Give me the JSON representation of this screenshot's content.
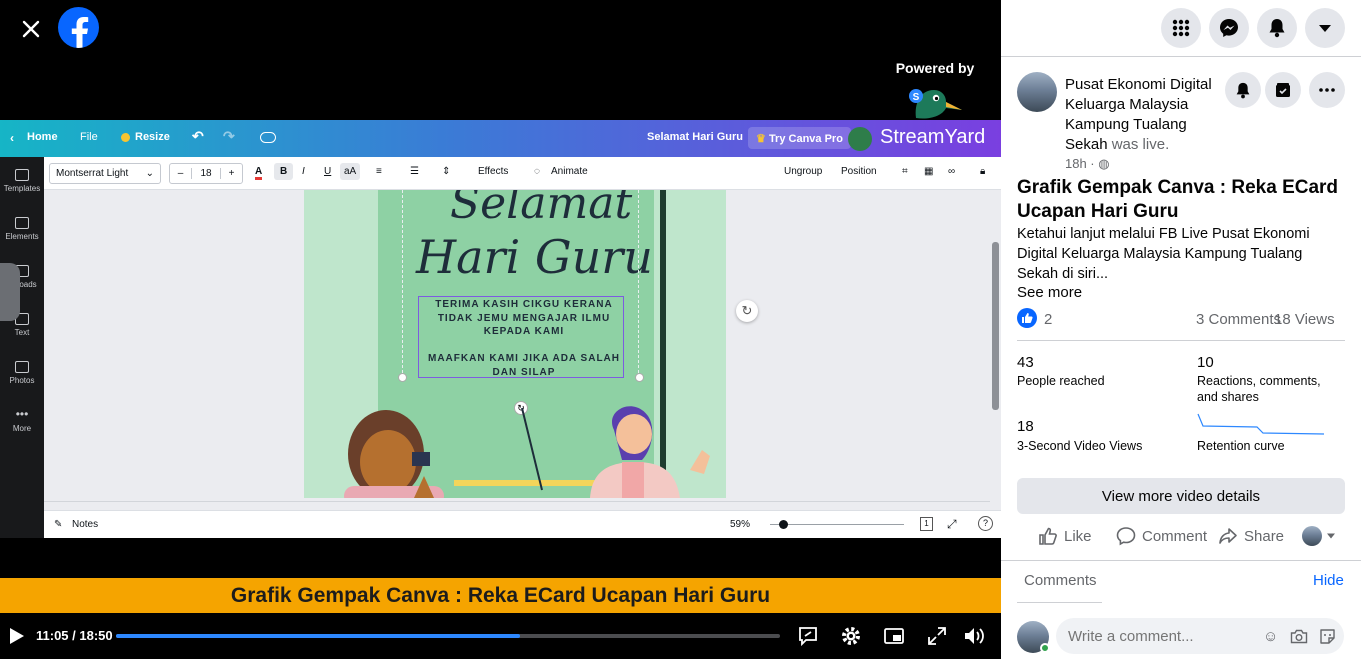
{
  "player": {
    "powered_by": "Powered by",
    "streamyard": "StreamYard",
    "title_banner": "Grafik Gempak Canva : Reka ECard Ucapan Hari Guru",
    "time": "11:05 / 18:50",
    "progress_fraction": 0.608
  },
  "canva": {
    "nav": {
      "home": "Home",
      "file": "File",
      "resize": "Resize",
      "doc_title": "Selamat Hari Guru",
      "try_pro": "Try Canva Pro"
    },
    "toolbar": {
      "font": "Montserrat Light",
      "minus": "–",
      "size": "18",
      "plus": "+",
      "bold": "B",
      "italic": "I",
      "underline": "U",
      "case": "aA",
      "effects": "Effects",
      "animate": "Animate",
      "ungroup": "Ungroup",
      "position": "Position"
    },
    "sidebar": [
      "Templates",
      "Elements",
      "Uploads",
      "Text",
      "Photos",
      "More"
    ],
    "card": {
      "script1": "Selamat",
      "script2": "Hari Guru",
      "line1": "TERIMA KASIH CIKGU KERANA",
      "line2": "TIDAK JEMU MENGAJAR ILMU",
      "line3": "KEPADA KAMI",
      "line4": "MAAFKAN KAMI JIKA ADA SALAH",
      "line5": "DAN SILAP"
    },
    "bottom": {
      "notes": "Notes",
      "zoom": "59%",
      "zoom_fraction": 0.1,
      "page": "1"
    }
  },
  "side": {
    "page_name": "Pusat Ekonomi Digital Keluarga Malaysia Kampung Tualang Sekah",
    "was_live": "was live.",
    "post_time": "18h ·",
    "video_title": "Grafik Gempak Canva : Reka ECard Ucapan Hari Guru",
    "description": "Ketahui lanjut melalui FB Live Pusat Ekonomi Digital Keluarga Malaysia Kampung Tualang Sekah di siri...",
    "see_more": "See more",
    "reaction_count": "2",
    "comment_count": "3 Comments",
    "view_count": "18 Views",
    "metrics": {
      "reached_num": "43",
      "reached_lbl": "People reached",
      "reactions_num": "10",
      "reactions_lbl": "Reactions, comments, and shares",
      "views3_num": "18",
      "views3_lbl": "3-Second Video Views",
      "retention_lbl": "Retention curve"
    },
    "more_details": "View more video details",
    "actions": {
      "like": "Like",
      "comment": "Comment",
      "share": "Share"
    },
    "comments_label": "Comments",
    "hide_label": "Hide",
    "comment_placeholder": "Write a comment..."
  },
  "colors": {
    "fb_blue": "#0866ff",
    "banner": "#f5a400",
    "progress": "#2d88ff"
  }
}
